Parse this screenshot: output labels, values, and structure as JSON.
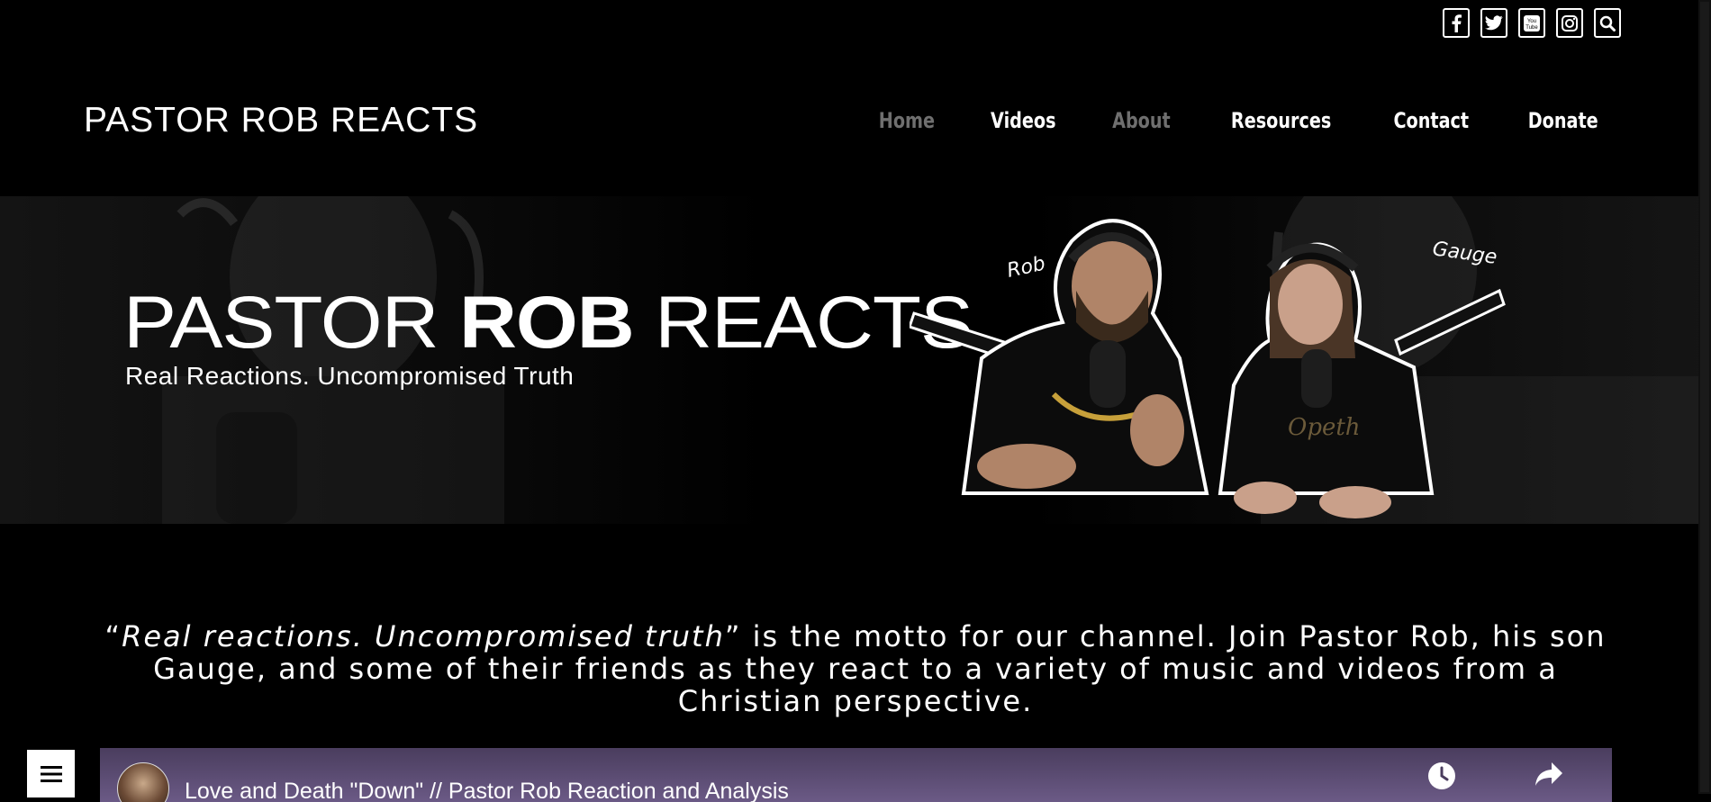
{
  "social": {
    "facebook": "facebook-icon",
    "twitter": "twitter-icon",
    "youtube": "youtube-icon",
    "instagram": "instagram-icon",
    "search": "search-icon"
  },
  "header": {
    "site_title": "PASTOR ROB REACTS"
  },
  "nav": {
    "items": [
      {
        "label": "Home",
        "state": "muted"
      },
      {
        "label": "Videos",
        "state": "active"
      },
      {
        "label": "About",
        "state": "muted"
      },
      {
        "label": "Resources",
        "state": "active"
      },
      {
        "label": "Contact",
        "state": "active"
      },
      {
        "label": "Donate",
        "state": "active"
      }
    ]
  },
  "hero": {
    "brand_light_1": "PASTOR ",
    "brand_bold": "ROB",
    "brand_light_2": " REACTS",
    "tagline": "Real Reactions. Uncompromised Truth",
    "name_left": "Rob",
    "name_right": "Gauge"
  },
  "intro": {
    "open_quote": "“",
    "motto": "Real reactions. Uncompromised truth",
    "rest": "” is the motto for our channel. Join Pastor Rob, his son Gauge, and some of their friends as they react to a variety of music and videos from a Christian perspective."
  },
  "video": {
    "title": "Love and Death \"Down\" // Pastor Rob Reaction and Analysis"
  },
  "colors": {
    "background": "#000000",
    "nav_muted": "#6f6f6f",
    "text": "#ffffff"
  }
}
